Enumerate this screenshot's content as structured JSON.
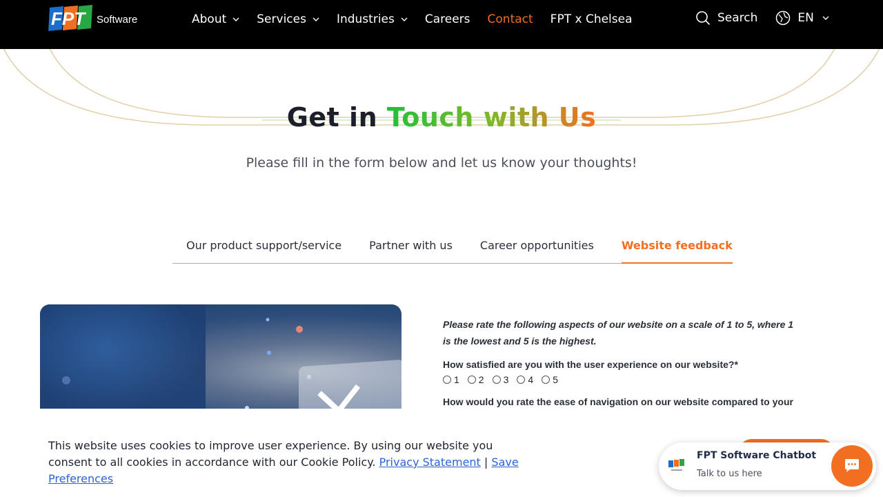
{
  "header": {
    "logo_text": "FPT",
    "logo_sub": "Software",
    "nav": [
      {
        "label": "About",
        "dropdown": true
      },
      {
        "label": "Services",
        "dropdown": true
      },
      {
        "label": "Industries",
        "dropdown": true
      },
      {
        "label": "Careers",
        "dropdown": false
      },
      {
        "label": "Contact",
        "dropdown": false,
        "active": true
      },
      {
        "label": "FPT x Chelsea",
        "dropdown": false
      }
    ],
    "search_label": "Search",
    "lang_label": "EN"
  },
  "hero": {
    "title_part1": "Get in",
    "title_part2": "Touch with Us",
    "subtitle": "Please fill in the form below and let us know your thoughts!"
  },
  "tabs": [
    {
      "label": "Our product support/service"
    },
    {
      "label": "Partner with us"
    },
    {
      "label": "Career opportunities"
    },
    {
      "label": "Website feedback",
      "active": true
    }
  ],
  "form": {
    "intro": "Please rate the following aspects of our website on a scale of 1 to 5, where 1 is the lowest and 5 is the highest.",
    "q1": "How satisfied are you with the user experience on our website?",
    "q1_required": "*",
    "ratings": [
      "1",
      "2",
      "3",
      "4",
      "5"
    ],
    "q2": "How would you rate the ease of navigation on our website compared to your"
  },
  "cookie": {
    "text": "This website uses cookies to improve user experience. By using our website you consent to all cookies in accordance with our Cookie Policy.",
    "privacy_link": "Privacy Statement",
    "separator": "|",
    "prefs_link": "Save Preferences"
  },
  "chatbot": {
    "title": "FPT Software Chatbot",
    "subtitle": "Talk to us here"
  },
  "colors": {
    "accent": "#f26f21",
    "header_bg": "#000000",
    "link": "#2b63d8"
  }
}
